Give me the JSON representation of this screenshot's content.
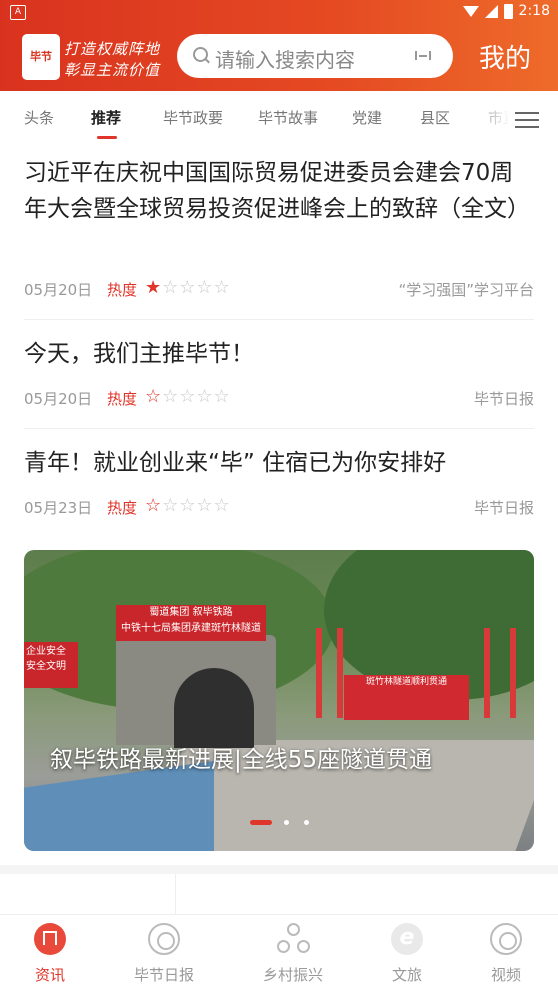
{
  "status_bar": {
    "app_badge": "A",
    "time": "2:18"
  },
  "header": {
    "logo_text": "毕节",
    "slogan_line1": "打造权威阵地",
    "slogan_line2": "彰显主流价值",
    "search_placeholder": "请输入搜索内容",
    "mine_label": "我的"
  },
  "tabs": [
    {
      "label": "头条"
    },
    {
      "label": "推荐",
      "active": true
    },
    {
      "label": "毕节政要"
    },
    {
      "label": "毕节故事"
    },
    {
      "label": "党建"
    },
    {
      "label": "县区"
    },
    {
      "label": "市直"
    }
  ],
  "articles": [
    {
      "title": "习近平在庆祝中国国际贸易促进委员会建会70周年大会暨全球贸易投资促进峰会上的致辞（全文）",
      "date": "05月20日",
      "heat_label": "热度",
      "heat_rating": 1,
      "source": "“学习强国”学习平台"
    },
    {
      "title": "今天，我们主推毕节！",
      "date": "05月20日",
      "heat_label": "热度",
      "heat_rating": 0.5,
      "source": "毕节日报"
    },
    {
      "title": "青年！就业创业来“毕” 住宿已为你安排好",
      "date": "05月23日",
      "heat_label": "热度",
      "heat_rating": 0.5,
      "source": "毕节日报"
    }
  ],
  "banner": {
    "caption": "叙毕铁路最新进展|全线55座隧道贯通",
    "sign_line1": "蜀道集团 叙毕铁路",
    "sign_line2": "中铁十七局集团承建斑竹林隧道",
    "left_banner": "企业安全 安全文明",
    "stage_banner": "斑竹林隧道顺利贯通",
    "slide_index": 1,
    "slide_count": 3
  },
  "bottom_nav": [
    {
      "label": "资讯",
      "icon": "home-icon",
      "active": true
    },
    {
      "label": "毕节日报",
      "icon": "ring-icon"
    },
    {
      "label": "乡村振兴",
      "icon": "nodes-icon"
    },
    {
      "label": "文旅",
      "icon": "e-icon"
    },
    {
      "label": "视频",
      "icon": "video-ring-icon"
    }
  ],
  "colors": {
    "brand": "#d9331f",
    "accent": "#e0352a"
  }
}
